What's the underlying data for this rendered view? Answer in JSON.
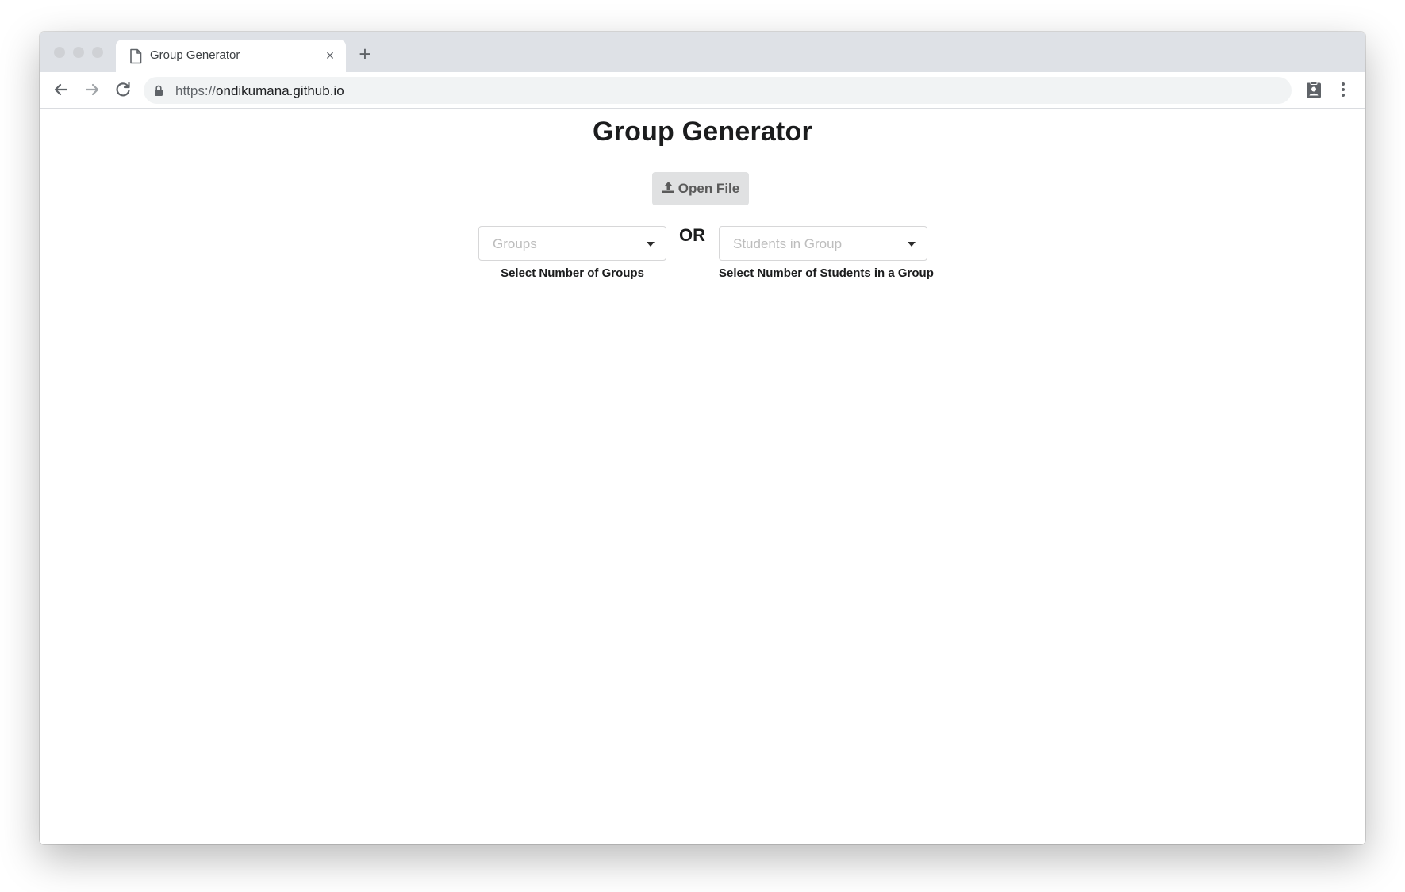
{
  "browser": {
    "tab": {
      "title": "Group Generator",
      "close_glyph": "×"
    },
    "new_tab_glyph": "+",
    "address": {
      "scheme": "https://",
      "host": "ondikumana.github.io"
    },
    "icons": {
      "tab_page": "page-icon",
      "back": "arrow-left-icon",
      "forward": "arrow-right-icon",
      "reload": "reload-icon",
      "lock": "lock-icon",
      "extension": "clipboard-badge-icon",
      "menu": "vertical-dots-icon"
    }
  },
  "page": {
    "title": "Group Generator",
    "open_file_button": {
      "label": "Open File",
      "icon": "upload-icon"
    },
    "groups_dropdown": {
      "placeholder": "Groups",
      "label": "Select Number of Groups"
    },
    "or_label": "OR",
    "students_dropdown": {
      "placeholder": "Students in Group",
      "label": "Select Number of Students in a Group"
    }
  },
  "colors": {
    "tabstrip": "#dee1e6",
    "omnibox": "#f1f3f4",
    "button_bg": "#e0e1e2",
    "button_text": "#5a5a5a",
    "placeholder_text": "#bdbdbd",
    "heading_text": "#1b1c1d"
  }
}
